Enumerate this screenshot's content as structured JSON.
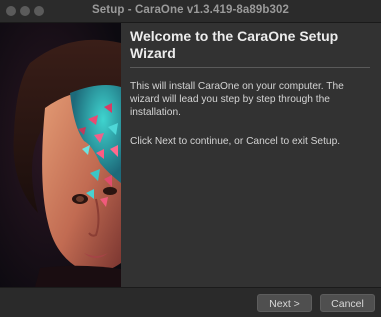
{
  "window": {
    "title": "Setup - CaraOne v1.3.419-8a89b302"
  },
  "main": {
    "heading_line1": "Welcome to the CaraOne Setup",
    "heading_line2": "Wizard",
    "paragraph1": "This will install CaraOne on your computer. The wizard will lead you step by step through the installation.",
    "paragraph2": "Click Next to continue, or Cancel to exit Setup."
  },
  "buttons": {
    "next": "Next >",
    "cancel": "Cancel"
  }
}
